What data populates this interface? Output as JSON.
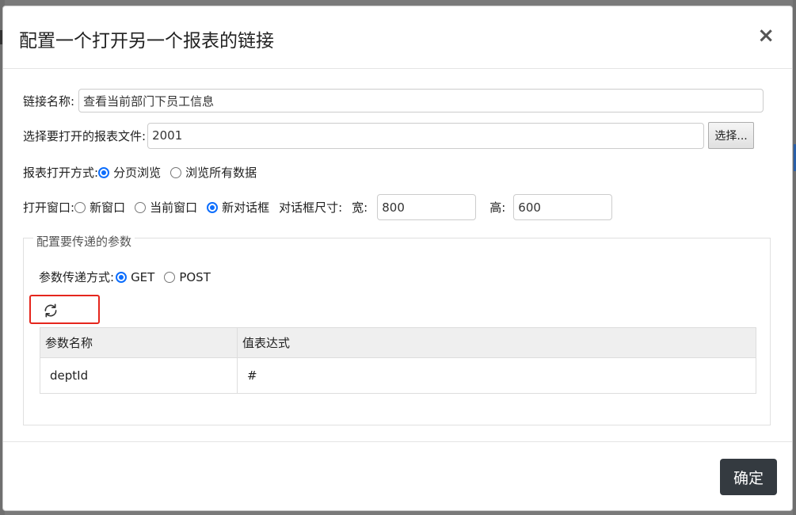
{
  "dialog": {
    "title": "配置一个打开另一个报表的链接",
    "close_symbol": "×"
  },
  "link_name": {
    "label": "链接名称:",
    "value": "查看当前部门下员工信息"
  },
  "report_file": {
    "label": "选择要打开的报表文件:",
    "value": "2001",
    "choose_label": "选择..."
  },
  "open_mode": {
    "label": "报表打开方式:",
    "options": [
      {
        "label": "分页浏览",
        "checked": true
      },
      {
        "label": "浏览所有数据",
        "checked": false
      }
    ]
  },
  "open_window": {
    "label": "打开窗口:",
    "options": [
      {
        "label": "新窗口",
        "checked": false
      },
      {
        "label": "当前窗口",
        "checked": false
      },
      {
        "label": "新对话框",
        "checked": true
      }
    ],
    "dialog_size_label": "对话框尺寸:",
    "width_label": "宽:",
    "width_value": "800",
    "height_label": "高:",
    "height_value": "600"
  },
  "params": {
    "legend": "配置要传递的参数",
    "method_label": "参数传递方式:",
    "methods": [
      {
        "label": "GET",
        "checked": true
      },
      {
        "label": "POST",
        "checked": false
      }
    ],
    "refresh_icon": "refresh-icon",
    "highlight_color": "#e5261d",
    "columns": [
      "参数名称",
      "值表达式"
    ],
    "rows": [
      [
        "deptId",
        "#"
      ]
    ]
  },
  "footer": {
    "ok_label": "确定"
  },
  "colors": {
    "accent": "#0d6efd",
    "ok_button": "#343a40"
  }
}
